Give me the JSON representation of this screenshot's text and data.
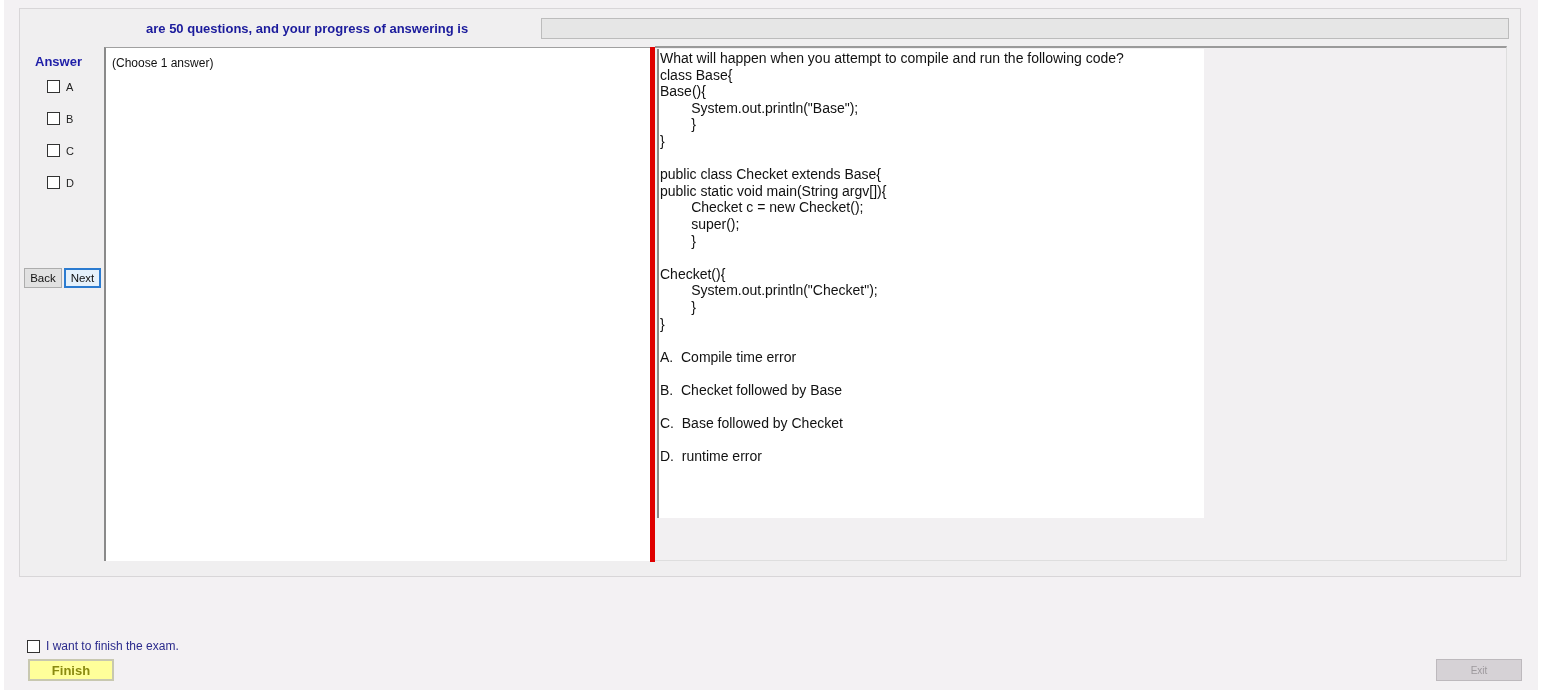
{
  "header": {
    "text": "are 50 questions, and your progress of answering is",
    "progress": {
      "level": 0
    }
  },
  "answer_panel": {
    "title": "Answer",
    "options": [
      {
        "label": "A",
        "checked": false
      },
      {
        "label": "B",
        "checked": false
      },
      {
        "label": "C",
        "checked": false
      },
      {
        "label": "D",
        "checked": false
      }
    ],
    "navigation": [
      {
        "label": "Back",
        "focused": false
      },
      {
        "label": "Next",
        "focused": true
      }
    ]
  },
  "instruction_pane": {
    "text": "(Choose 1 answer)"
  },
  "question_pane": {
    "prompt": "What will happen when you attempt to compile and run the following code?",
    "code_blocks": [
      [
        "class Base{",
        "Base(){",
        "\tSystem.out.println(\"Base\");",
        "\t}",
        "}"
      ],
      [
        "public class Checket extends Base{",
        "public static void main(String argv[]){",
        "\tChecket c = new Checket();",
        "\tsuper();",
        "\t}"
      ],
      [
        "Checket(){",
        "\tSystem.out.println(\"Checket\");",
        "\t}",
        "}"
      ]
    ],
    "choices": [
      "A.  Compile time error",
      "B.  Checket followed by Base",
      "C.  Base followed by Checket",
      "D.  runtime error"
    ]
  },
  "footer": {
    "confirm": {
      "label": "I want to finish the exam.",
      "checked": false
    },
    "finish_button": {
      "label": "Finish"
    },
    "exit_button": {
      "label": "Exit",
      "disabled": true
    }
  }
}
